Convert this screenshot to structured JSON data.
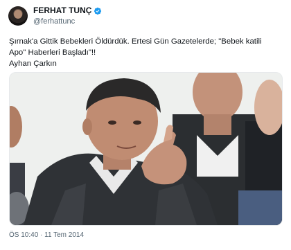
{
  "author": {
    "display_name": "FERHAT TUNÇ",
    "handle": "@ferhattunc",
    "verified": true,
    "verified_color": "#1d9bf0"
  },
  "tweet": {
    "lines": [
      "Şırnak'a Gittik Bebekleri Öldürdük. Ertesi Gün Gazetelerde; \"Bebek katili",
      "Apo\" Haberleri Başladı\"!!",
      "Ayhan Çarkın"
    ]
  },
  "media": {
    "description_icon": "photo"
  },
  "timestamp": "ÖS 10:40 · 11 Tem 2014"
}
